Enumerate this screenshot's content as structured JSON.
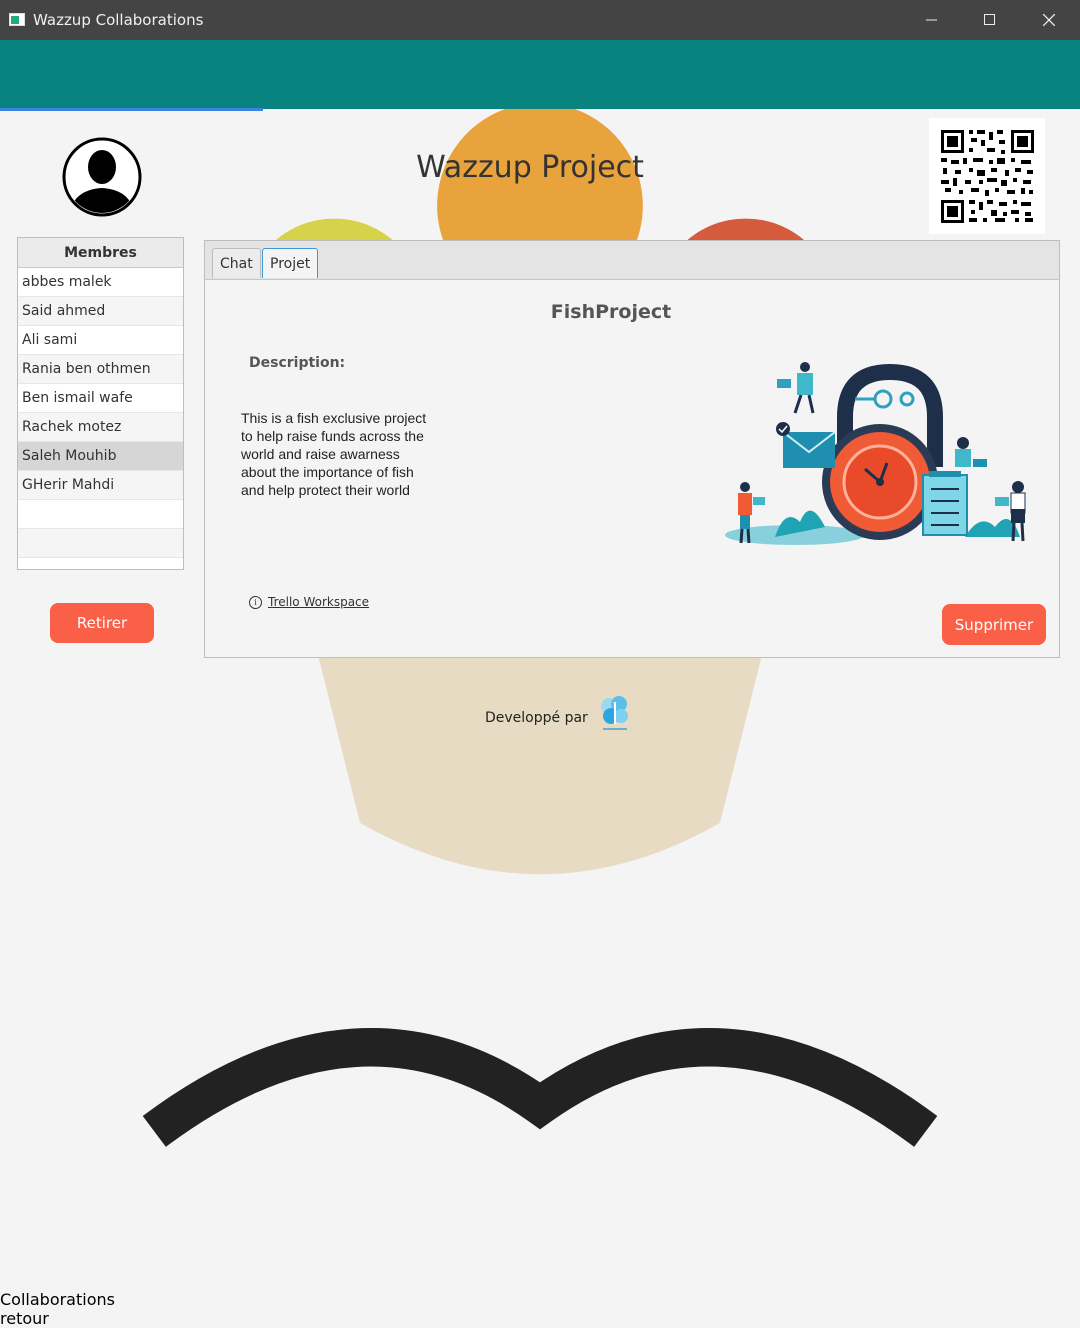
{
  "window": {
    "title": "Wazzup Collaborations",
    "minimize": "—",
    "maximize": "☐",
    "close": "✕"
  },
  "header": {
    "title": "Collaborations",
    "back_label": "retour"
  },
  "project": {
    "title": "Wazzup Project"
  },
  "members": {
    "header": "Membres",
    "items": [
      "abbes malek",
      "Said ahmed",
      "Ali sami",
      "Rania ben othmen",
      "Ben ismail wafe",
      "Rachek motez",
      "Saleh Mouhib",
      "GHerir Mahdi"
    ],
    "selected": "Saleh Mouhib"
  },
  "buttons": {
    "remove": "Retirer",
    "delete": "Supprimer"
  },
  "tabs": {
    "chat": "Chat",
    "projet": "Projet",
    "active": "Projet"
  },
  "projet": {
    "name": "FishProject",
    "description_label": "Description:",
    "description": "This is a fish exclusive project to help raise funds across the world and raise awarness about the importance of fish and help protect their world",
    "link": "Trello Workspace"
  },
  "footer": {
    "developed_by": "Developpé par"
  },
  "colors": {
    "header": "#088380",
    "accent_button": "#fa5f47",
    "progress": "#3a83e0"
  }
}
